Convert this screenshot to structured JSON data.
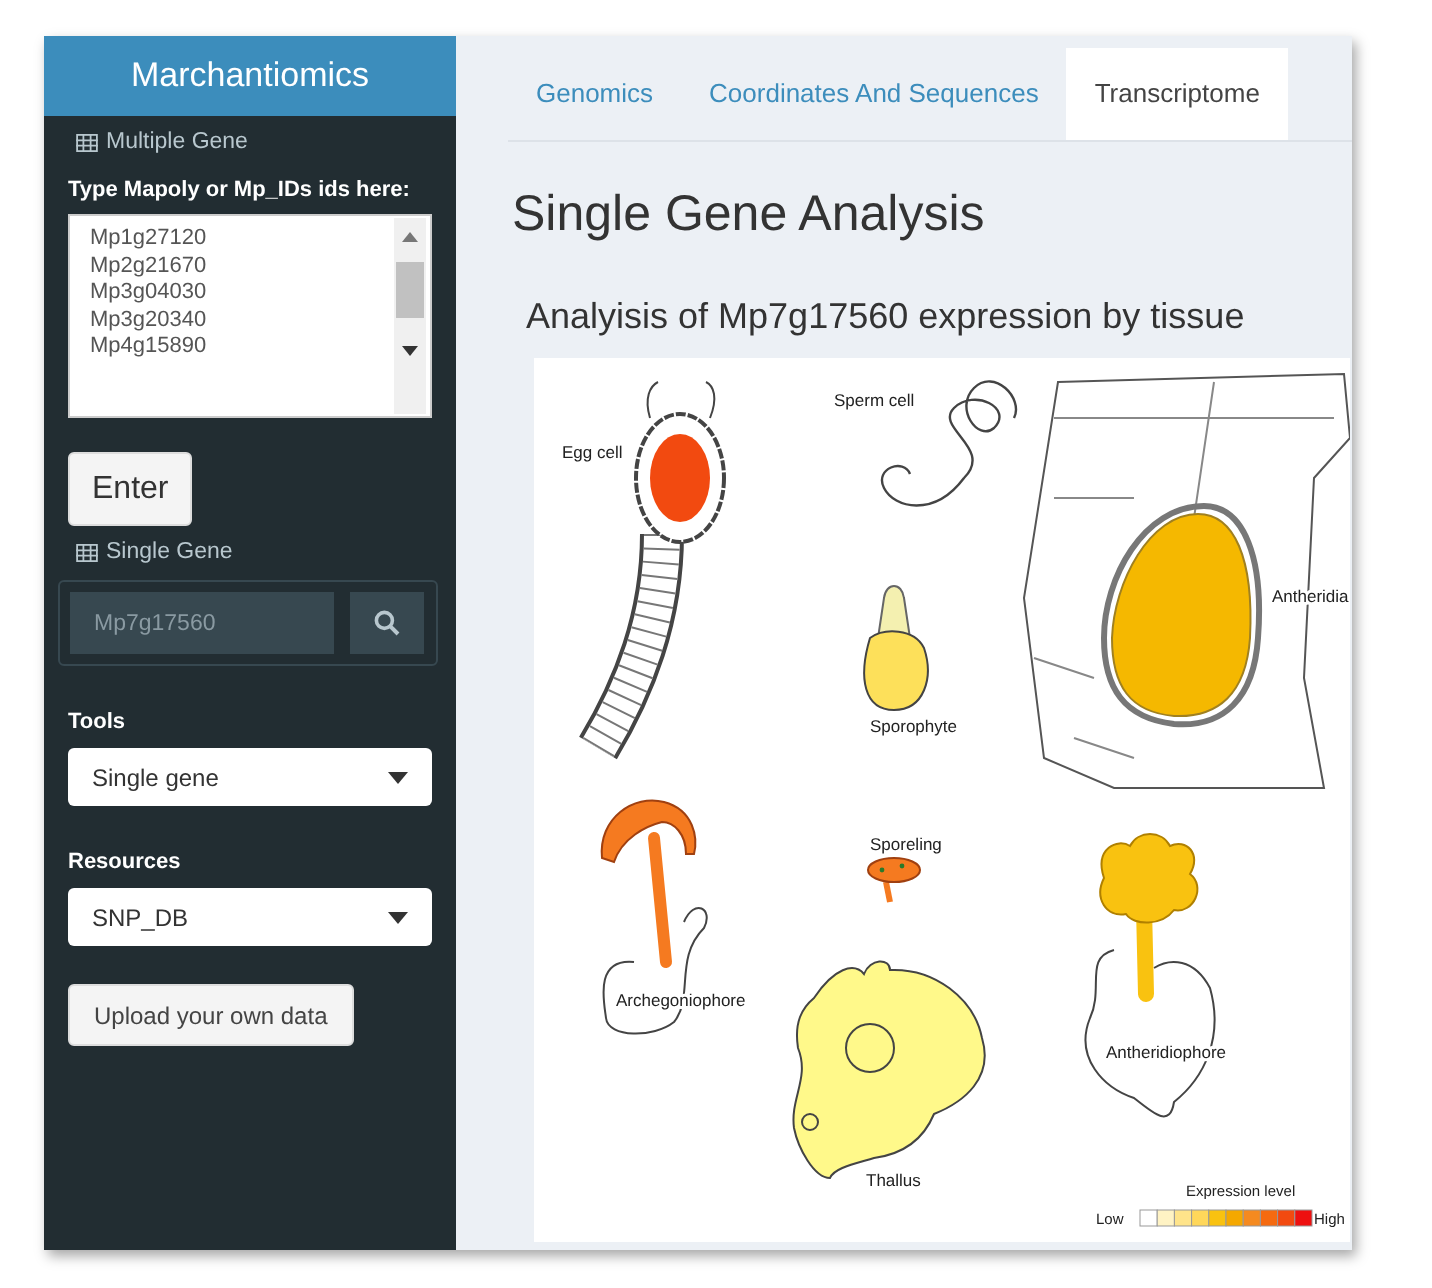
{
  "app_title": "Marchantiomics",
  "sidebar": {
    "multiple_gene": {
      "heading": "Multiple Gene",
      "label": "Type Mapoly or Mp_IDs ids here:",
      "ids": [
        "Mp1g27120",
        "Mp2g21670",
        "Mp3g04030",
        "Mp3g20340",
        "Mp4g15890"
      ],
      "button": "Enter"
    },
    "single_gene": {
      "heading": "Single Gene",
      "placeholder": "Mp7g17560"
    },
    "tools": {
      "label": "Tools",
      "value": "Single gene"
    },
    "resources": {
      "label": "Resources",
      "value": "SNP_DB"
    },
    "upload_button": "Upload your own data"
  },
  "tabs": [
    {
      "label": "Genomics",
      "selected": false
    },
    {
      "label": "Coordinates And Sequences",
      "selected": false
    },
    {
      "label": "Transcriptome",
      "selected": true
    }
  ],
  "page_title": "Single Gene Analysis",
  "figure": {
    "title": "Analyisis of Mp7g17560 expression by tissue",
    "tissues": [
      {
        "kind": "egg",
        "label": "Egg cell",
        "color": "#f24a10"
      },
      {
        "kind": "sperm",
        "label": "Sperm cell"
      },
      {
        "kind": "sporophyte",
        "label": "Sporophyte",
        "color": "#fde05a"
      },
      {
        "kind": "antheridia",
        "label": "Antheridia",
        "color": "#f5b800"
      },
      {
        "kind": "archegoniophore",
        "label": "Archegoniophore",
        "color": "#f57a20"
      },
      {
        "kind": "sporeling",
        "label": "Sporeling",
        "color": "#f57a20"
      },
      {
        "kind": "thallus",
        "label": "Thallus",
        "color": "#fff98a"
      },
      {
        "kind": "antheridiophore",
        "label": "Antheridiophore",
        "color": "#f9c210"
      }
    ],
    "legend": {
      "title": "Expression level",
      "low": "Low",
      "high": "High",
      "swatches": [
        {
          "color": "#ffffff"
        },
        {
          "color": "#fff3c4"
        },
        {
          "color": "#ffe48a"
        },
        {
          "color": "#ffd75a"
        },
        {
          "color": "#f9c210"
        },
        {
          "color": "#f5a800"
        },
        {
          "color": "#f58a20"
        },
        {
          "color": "#f56a10"
        },
        {
          "color": "#f24a10"
        },
        {
          "color": "#ee1010"
        }
      ]
    }
  }
}
